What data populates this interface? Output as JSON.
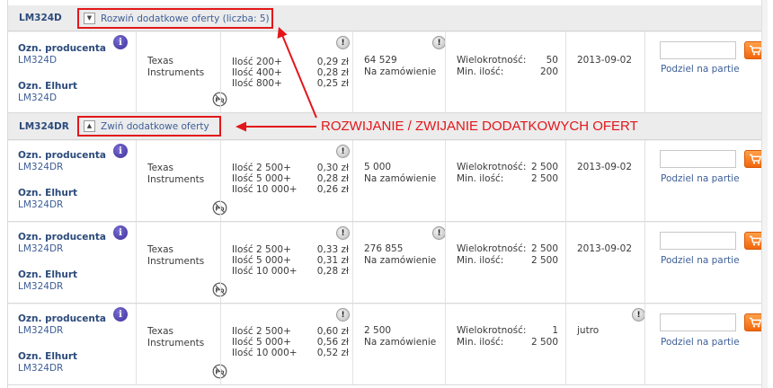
{
  "groups": [
    {
      "title": "LM324D",
      "toggle_label": "Rozwiń dodatkowe oferty (liczba: 5)",
      "toggle_icon": "chevron-down-icon"
    },
    {
      "title": "LM324DR",
      "toggle_label": "Zwiń dodatkowe oferty",
      "toggle_icon": "chevron-up-icon"
    }
  ],
  "labels": {
    "producer_code": "Ozn. producenta",
    "elhurt_code": "Ozn. Elhurt",
    "multiple": "Wielokrotność:",
    "min_qty": "Min. ilość:",
    "split": "Podziel na partie"
  },
  "offers": [
    {
      "producer_code": "LM324D",
      "elhurt_code": "LM324D",
      "manufacturer": [
        "Texas",
        "Instruments"
      ],
      "tiers": [
        {
          "qty": "Ilość 200+",
          "price": "0,29 zł"
        },
        {
          "qty": "Ilość 400+",
          "price": "0,28 zł"
        },
        {
          "qty": "Ilość 800+",
          "price": "0,25 zł"
        }
      ],
      "stock": "64 529",
      "stock_status": "Na zamówienie",
      "multiple": "50",
      "min_qty": "200",
      "date": "2013-09-02"
    },
    {
      "producer_code": "LM324DR",
      "elhurt_code": "LM324DR",
      "manufacturer": [
        "Texas",
        "Instruments"
      ],
      "tiers": [
        {
          "qty": "Ilość 2 500+",
          "price": "0,30 zł"
        },
        {
          "qty": "Ilość 5 000+",
          "price": "0,28 zł"
        },
        {
          "qty": "Ilość 10 000+",
          "price": "0,26 zł"
        }
      ],
      "stock": "5 000",
      "stock_status": "Na zamówienie",
      "multiple": "2 500",
      "min_qty": "2 500",
      "date": "2013-09-02"
    },
    {
      "producer_code": "LM324DR",
      "elhurt_code": "LM324DR",
      "manufacturer": [
        "Texas",
        "Instruments"
      ],
      "tiers": [
        {
          "qty": "Ilość 2 500+",
          "price": "0,33 zł"
        },
        {
          "qty": "Ilość 5 000+",
          "price": "0,31 zł"
        },
        {
          "qty": "Ilość 10 000+",
          "price": "0,28 zł"
        }
      ],
      "stock": "276 855",
      "stock_status": "Na zamówienie",
      "multiple": "2 500",
      "min_qty": "2 500",
      "date": "2013-09-02"
    },
    {
      "producer_code": "LM324DR",
      "elhurt_code": "LM324DR",
      "manufacturer": [
        "Texas",
        "Instruments"
      ],
      "tiers": [
        {
          "qty": "Ilość 2 500+",
          "price": "0,60 zł"
        },
        {
          "qty": "Ilość 5 000+",
          "price": "0,56 zł"
        },
        {
          "qty": "Ilość 10 000+",
          "price": "0,52 zł"
        }
      ],
      "stock": "2 500",
      "stock_status": "Na zamówienie",
      "multiple": "1",
      "min_qty": "2 500",
      "date": "jutro"
    }
  ],
  "annotation": {
    "text": "ROZWIJANIE / ZWIJANIE DODATKOWYCH OFERT",
    "color": "#e3161a"
  },
  "colors": {
    "header_bg": "#ececec",
    "link": "#3d5e98",
    "title": "#2b4a7b",
    "cart": "#f2660b",
    "annotation": "#e3161a"
  }
}
